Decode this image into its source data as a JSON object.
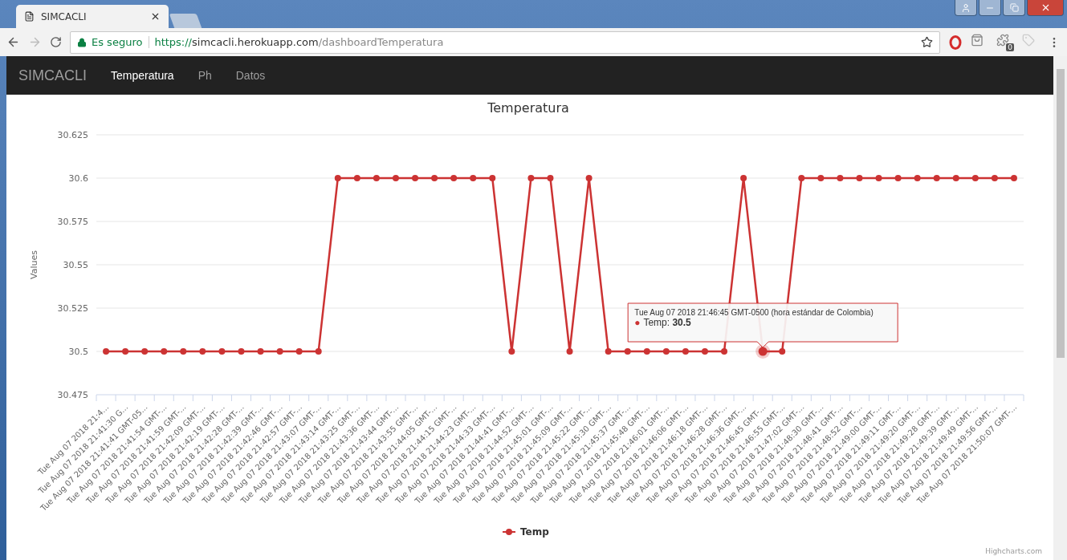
{
  "browser": {
    "tab": {
      "title": "SIMCACLI"
    },
    "address": {
      "security": "Es seguro",
      "scheme": "https://",
      "host": "simcacli.herokuapp.com",
      "path": "/dashboardTemperatura"
    },
    "extension_badge": "0"
  },
  "navbar": {
    "brand": "SIMCACLI",
    "items": [
      {
        "label": "Temperatura",
        "selected": true
      },
      {
        "label": "Ph",
        "selected": false
      },
      {
        "label": "Datos",
        "selected": false
      }
    ]
  },
  "chart": {
    "chart_data": {
      "type": "line",
      "title": "Temperatura",
      "ylabel": "Values",
      "categories": [
        "Tue Aug 07 2018 21:4...",
        "Tue Aug 07 2018 21:41:30 G...",
        "Tue Aug 07 2018 21:41:41 GMT-05...",
        "Tue Aug 07 2018 21:41:54 GMT-...",
        "Tue Aug 07 2018 21:41:59 GMT-...",
        "Tue Aug 07 2018 21:42:09 GMT-...",
        "Tue Aug 07 2018 21:42:19 GMT-...",
        "Tue Aug 07 2018 21:42:28 GMT-...",
        "Tue Aug 07 2018 21:42:39 GMT-...",
        "Tue Aug 07 2018 21:42:46 GMT-...",
        "Tue Aug 07 2018 21:42:57 GMT-...",
        "Tue Aug 07 2018 21:43:07 GMT-...",
        "Tue Aug 07 2018 21:43:14 GMT-...",
        "Tue Aug 07 2018 21:43:25 GMT-...",
        "Tue Aug 07 2018 21:43:36 GMT-...",
        "Tue Aug 07 2018 21:43:44 GMT-...",
        "Tue Aug 07 2018 21:43:55 GMT-...",
        "Tue Aug 07 2018 21:44:05 GMT-...",
        "Tue Aug 07 2018 21:44:15 GMT-...",
        "Tue Aug 07 2018 21:44:23 GMT-...",
        "Tue Aug 07 2018 21:44:33 GMT-...",
        "Tue Aug 07 2018 21:44:41 GMT-...",
        "Tue Aug 07 2018 21:44:52 GMT-...",
        "Tue Aug 07 2018 21:45:01 GMT-...",
        "Tue Aug 07 2018 21:45:09 GMT-...",
        "Tue Aug 07 2018 21:45:22 GMT-...",
        "Tue Aug 07 2018 21:45:30 GMT-...",
        "Tue Aug 07 2018 21:45:37 GMT-...",
        "Tue Aug 07 2018 21:45:48 GMT-...",
        "Tue Aug 07 2018 21:46:01 GMT-...",
        "Tue Aug 07 2018 21:46:06 GMT-...",
        "Tue Aug 07 2018 21:46:18 GMT-...",
        "Tue Aug 07 2018 21:46:28 GMT-...",
        "Tue Aug 07 2018 21:46:36 GMT-...",
        "Tue Aug 07 2018 21:46:45 GMT-...",
        "Tue Aug 07 2018 21:46:55 GMT-...",
        "Tue Aug 07 2018 21:47:02 GMT-...",
        "Tue Aug 07 2018 21:48:30 GMT-...",
        "Tue Aug 07 2018 21:48:41 GMT-...",
        "Tue Aug 07 2018 21:48:52 GMT-...",
        "Tue Aug 07 2018 21:49:00 GMT-...",
        "Tue Aug 07 2018 21:49:11 GMT-...",
        "Tue Aug 07 2018 21:49:20 GMT-...",
        "Tue Aug 07 2018 21:49:28 GMT-...",
        "Tue Aug 07 2018 21:49:39 GMT-...",
        "Tue Aug 07 2018 21:49:49 GMT-...",
        "Tue Aug 07 2018 21:49:56 GMT-...",
        "Tue Aug 07 2018 21:50:07 GMT-..."
      ],
      "series": [
        {
          "name": "Temp",
          "color": "#cc3333",
          "marker": true,
          "values": [
            30.5,
            30.5,
            30.5,
            30.5,
            30.5,
            30.5,
            30.5,
            30.5,
            30.5,
            30.5,
            30.5,
            30.5,
            30.6,
            30.6,
            30.6,
            30.6,
            30.6,
            30.6,
            30.6,
            30.6,
            30.6,
            30.5,
            30.6,
            30.6,
            30.5,
            30.6,
            30.5,
            30.5,
            30.5,
            30.5,
            30.5,
            30.5,
            30.5,
            30.6,
            30.5,
            30.5,
            30.6,
            30.6,
            30.6,
            30.6,
            30.6,
            30.6,
            30.6,
            30.6,
            30.6,
            30.6,
            30.6,
            30.6
          ]
        }
      ],
      "ylim": [
        30.475,
        30.625
      ],
      "yticks": [
        30.475,
        30.5,
        30.525,
        30.55,
        30.575,
        30.6,
        30.625
      ],
      "grid": true
    },
    "points": [
      {
        "hovered": false
      },
      {
        "hovered": false
      },
      {
        "hovered": false
      },
      {
        "hovered": false
      },
      {
        "hovered": false
      },
      {
        "hovered": false
      },
      {
        "hovered": false
      },
      {
        "hovered": false
      },
      {
        "hovered": false
      },
      {
        "hovered": false
      },
      {
        "hovered": false
      },
      {
        "hovered": false
      },
      {
        "hovered": false
      },
      {
        "hovered": false
      },
      {
        "hovered": false
      },
      {
        "hovered": false
      },
      {
        "hovered": false
      },
      {
        "hovered": false
      },
      {
        "hovered": false
      },
      {
        "hovered": false
      },
      {
        "hovered": false
      },
      {
        "hovered": false
      },
      {
        "hovered": false
      },
      {
        "hovered": false
      },
      {
        "hovered": false
      },
      {
        "hovered": false
      },
      {
        "hovered": false
      },
      {
        "hovered": false
      },
      {
        "hovered": false
      },
      {
        "hovered": false
      },
      {
        "hovered": false
      },
      {
        "hovered": false
      },
      {
        "hovered": false
      },
      {
        "hovered": false
      },
      {
        "hovered": true
      },
      {
        "hovered": false
      },
      {
        "hovered": false
      },
      {
        "hovered": false
      },
      {
        "hovered": false
      },
      {
        "hovered": false
      },
      {
        "hovered": false
      },
      {
        "hovered": false
      },
      {
        "hovered": false
      },
      {
        "hovered": false
      },
      {
        "hovered": false
      },
      {
        "hovered": false
      },
      {
        "hovered": false
      },
      {
        "hovered": false
      }
    ],
    "tooltip": {
      "title": "Tue Aug 07 2018 21:46:45 GMT-0500 (hora estándar de Colombia)",
      "marker": "●",
      "text": "Temp: **30.5**"
    },
    "credits": "Highcharts.com"
  }
}
